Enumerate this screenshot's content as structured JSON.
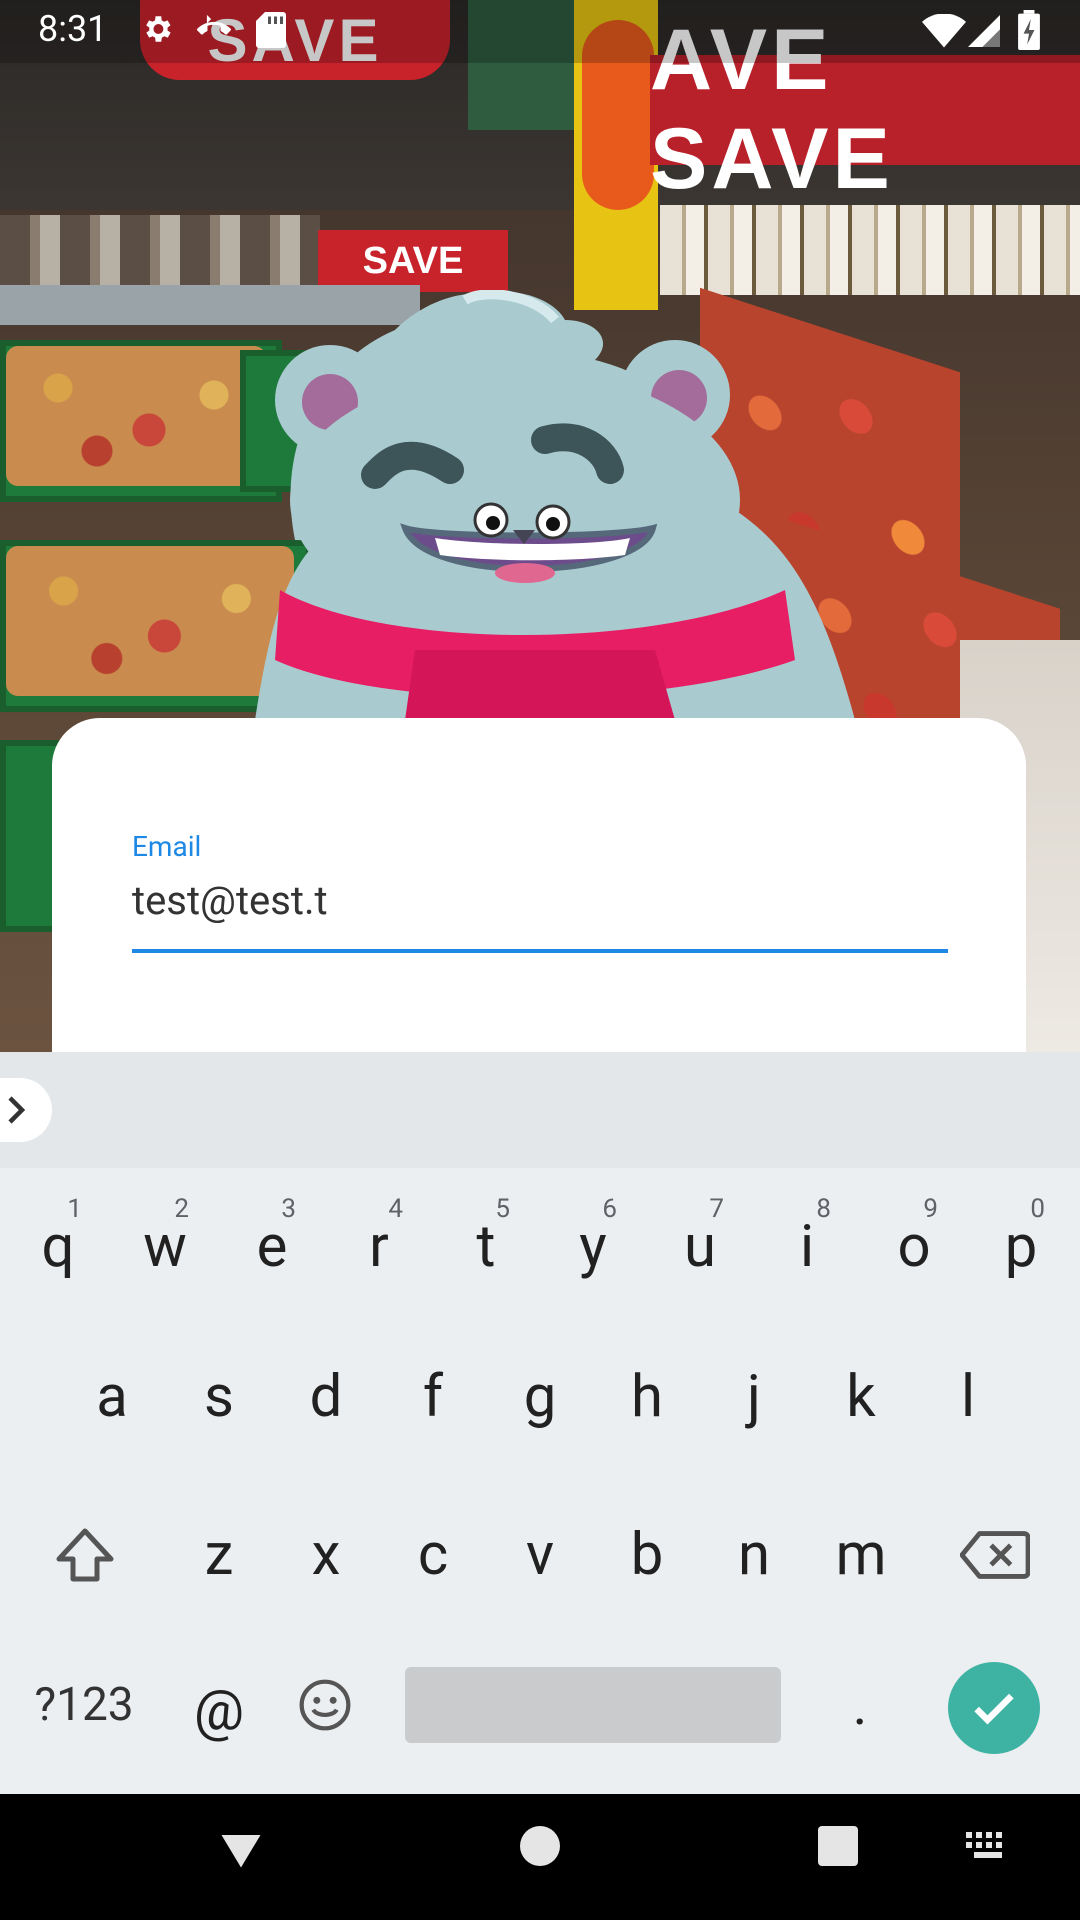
{
  "status_bar": {
    "time": "8:31",
    "icons": [
      "settings-icon",
      "call-icon",
      "sd-card-icon",
      "wifi-icon",
      "signal-icon",
      "battery-icon"
    ]
  },
  "background": {
    "signs": [
      "SAVE",
      "AVE SAVE",
      "SAVE"
    ]
  },
  "form": {
    "email_label": "Email",
    "email_value": "test@test.t",
    "accent_color": "#1e88e5"
  },
  "keyboard": {
    "row1": [
      {
        "key": "q",
        "hint": "1"
      },
      {
        "key": "w",
        "hint": "2"
      },
      {
        "key": "e",
        "hint": "3"
      },
      {
        "key": "r",
        "hint": "4"
      },
      {
        "key": "t",
        "hint": "5"
      },
      {
        "key": "y",
        "hint": "6"
      },
      {
        "key": "u",
        "hint": "7"
      },
      {
        "key": "i",
        "hint": "8"
      },
      {
        "key": "o",
        "hint": "9"
      },
      {
        "key": "p",
        "hint": "0"
      }
    ],
    "row2": [
      "a",
      "s",
      "d",
      "f",
      "g",
      "h",
      "j",
      "k",
      "l"
    ],
    "row3": [
      "z",
      "x",
      "c",
      "v",
      "b",
      "n",
      "m"
    ],
    "symbols_label": "?123",
    "at_label": "@",
    "period_label": ".",
    "enter_color": "#3eb3a3"
  },
  "nav_bar": {
    "buttons": [
      "back-icon",
      "home-icon",
      "recents-icon",
      "keyboard-switch-icon"
    ]
  }
}
